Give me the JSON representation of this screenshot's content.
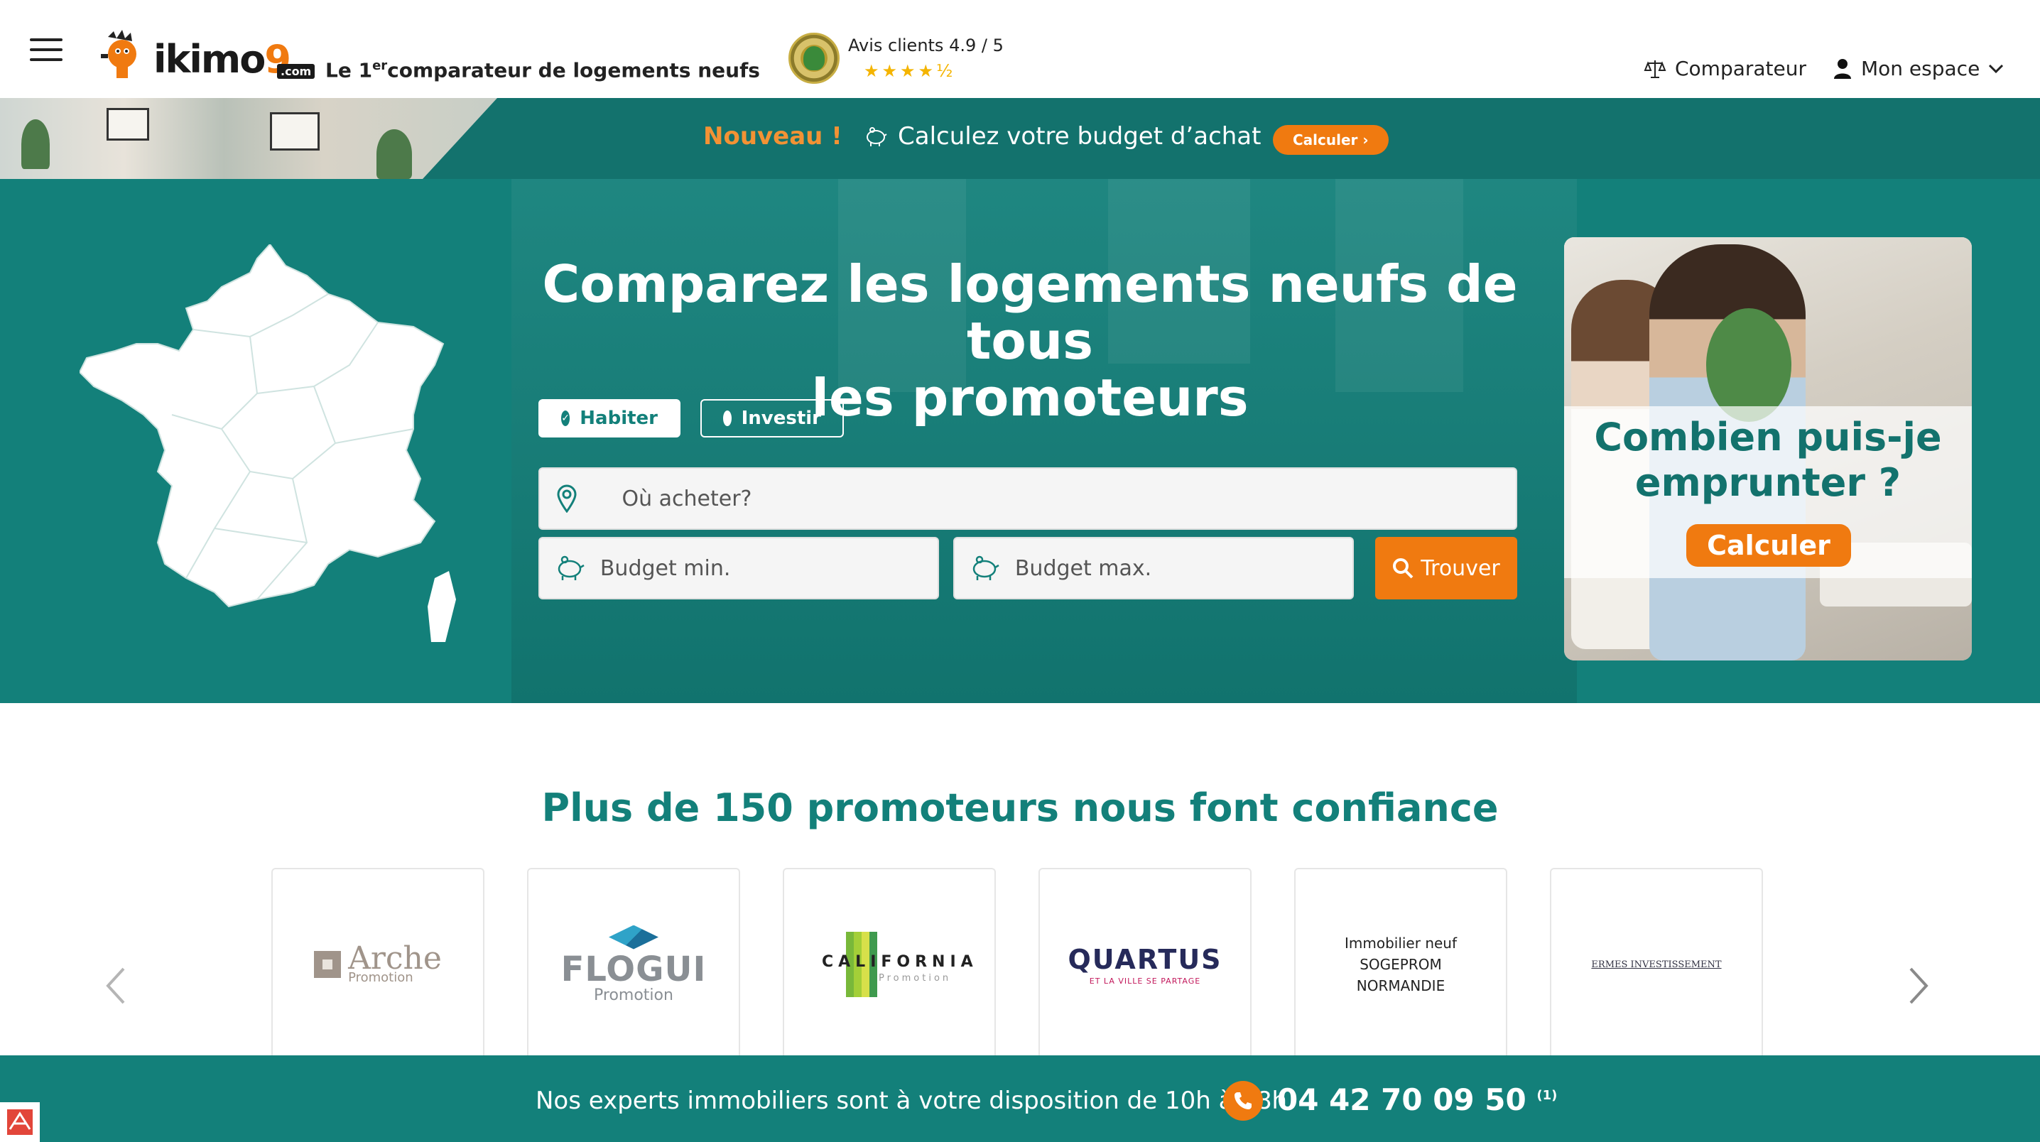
{
  "header": {
    "logo_text": "ikimo",
    "logo_nine": "9",
    "logo_com": ".com",
    "tagline_pre": "Le 1",
    "tagline_sup": "er",
    "tagline_post": "comparateur de logements neufs",
    "reviews_label": "Avis clients 4.9 / 5",
    "reviews_rating": 4.9,
    "reviews_stars_text": "★★★★½",
    "nav_comparateur": "Comparateur",
    "nav_espace": "Mon espace"
  },
  "promo_banner": {
    "new_label": "Nouveau !",
    "text": "Calculez votre budget d’achat",
    "button": "Calculer ›"
  },
  "hero": {
    "title_line1": "Comparez les logements neufs de tous",
    "title_line2": "les promoteurs",
    "toggle_habiter": "Habiter",
    "toggle_investir": "Investir",
    "where_placeholder": "Où acheter?",
    "budget_min_placeholder": "Budget min.",
    "budget_max_placeholder": "Budget max.",
    "find_button": "Trouver"
  },
  "side_card": {
    "title_line1": "Combien puis-je",
    "title_line2": "emprunter ?",
    "button": "Calculer"
  },
  "partners": {
    "title": "Plus de 150 promoteurs nous font confiance",
    "arche": {
      "name": "Arche",
      "sub": "Promotion"
    },
    "flogui": {
      "name": "FLOGUI",
      "sub": "Promotion"
    },
    "california": {
      "name": "CALIFORNIA",
      "sub": "Promotion"
    },
    "quartus": {
      "name": "QUARTUS",
      "sub": "ET LA VILLE SE PARTAGE"
    },
    "sogeprom": {
      "line1": "Immobilier neuf",
      "line2": "SOGEPROM",
      "line3": "NORMANDIE"
    },
    "ermes": {
      "name": "ERMES INVESTISSEMENT"
    }
  },
  "bottom_bar": {
    "text": "Nos experts immobiliers sont à votre disposition de 10h à 18h.",
    "phone": "04 42 70 09 50",
    "phone_note": "(1)"
  },
  "colors": {
    "teal": "#13807a",
    "teal_dark": "#13726d",
    "orange": "#f07a10",
    "promo_orange_text": "#f39234"
  },
  "icons": [
    "menu-icon",
    "mascot-icon",
    "award-seal-icon",
    "scale-icon",
    "user-icon",
    "chevron-down-icon",
    "piggy-bank-icon",
    "map-pin-icon",
    "search-icon",
    "chevron-left-icon",
    "chevron-right-icon",
    "phone-icon",
    "check-icon"
  ]
}
